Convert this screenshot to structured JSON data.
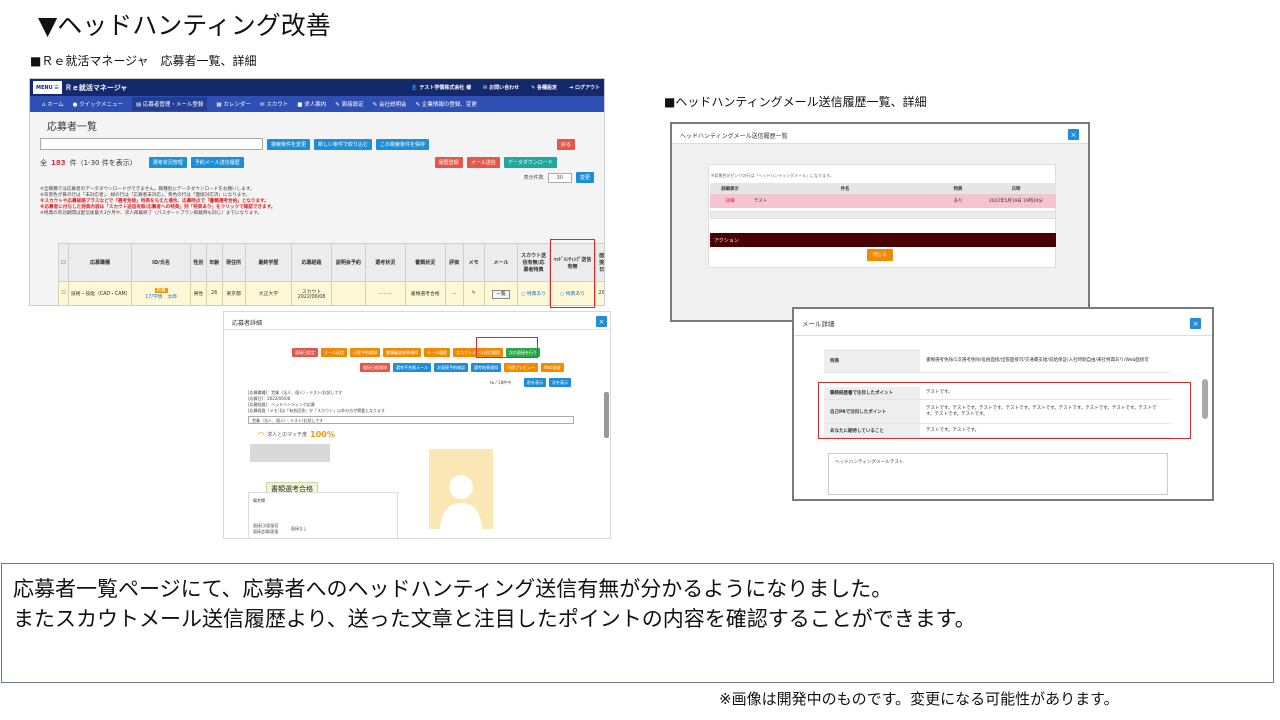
{
  "slide": {
    "title": "▼ヘッドハンティング改善",
    "left_label": "■Ｒｅ就活マネージャ　応募者一覧、詳細",
    "right_label": "■ヘッドハンティングメール送信履歴一覧、詳細",
    "caption_line1": "応募者一覧ページにて、応募者へのヘッドハンティング送信有無が分かるようになりました。",
    "caption_line2": "またスカウトメール送信履歴より、送った文章と注目したポイントの内容を確認することができます。",
    "footnote": "※画像は開発中のものです。変更になる可能性があります。"
  },
  "list_screen": {
    "menu": "MENU",
    "brand": "Ｒｅ就活マネージャ",
    "user": "テスト学情株式会社 様",
    "contact": "お問い合わせ",
    "manual": "各種設定",
    "logout": "ログアウト",
    "nav": [
      "ホーム",
      "クイックメニュー",
      "応募者管理・メール登録",
      "カレンダー",
      "スカウト",
      "求人案内",
      "面接設定",
      "会社説明会",
      "企業情報の登録、変更"
    ],
    "page_title": "応募者一覧",
    "buttons": {
      "change_search": "検索条件を変更",
      "new_search": "新しい条件で絞り込む",
      "save_search": "この検索条件を保存",
      "back": "戻る",
      "status": "選考状況管理",
      "reserve": "予約メール送信履歴",
      "history": "履歴登録",
      "mail": "メール送信",
      "download": "データダウンロード",
      "apply": "変更"
    },
    "count_prefix": "全",
    "count": "183",
    "count_suffix": "件（1-30 件を表示）",
    "per_page_label": "表示件数",
    "per_page": "30",
    "notes": [
      "※全職種では応募者のデータダウンロードができません。職種別にデータダウンロードをお願いします。",
      "※背景色が黄の行は「未対応者」、緑の行は「応募者未対応」、青色の行は「面接対応済」になります。",
      "※スカウトや応募経路プラスなどで「選考免除」特典を与えた場合、応募時点で「書類選考合格」となります。",
      "※応募者に付与した特典内容は「スカウト送信有無/応募者への特典」列「特典あり」をクリックで確認できます。",
      "※特典の有効期間は配信後最大3か月や、求人掲載終了（パスポートプラン掲載時も同じ）までになります。"
    ],
    "table_headers": [
      "応募職種",
      "ID/氏名",
      "性別",
      "年齢",
      "現住所",
      "最終学歴",
      "応募経路",
      "説明会予約",
      "選考状況",
      "書類状況",
      "評価",
      "メモ",
      "メール",
      "スカウト送信有無/応募者特典",
      "ﾍｯﾄﾞﾊﾝﾃｨﾝｸﾞ送信有無",
      "面接日"
    ],
    "row": {
      "job": "技術・技能（CAD・CAM）",
      "tag": "新着",
      "id": "17/学情　太郎",
      "gender": "男性",
      "age": "26",
      "address": "東京都",
      "school": "大正大学",
      "route": "スカウト 2022/06/08",
      "seminar": "",
      "selection": "－－－",
      "doc_status": "書類選考合格",
      "rating": "－",
      "memo": "✎",
      "mail": "一覧",
      "scout": "○ 特典あり",
      "headhunt": "○ 特典あり",
      "date": "20"
    }
  },
  "detail_screen": {
    "title": "応募者詳細",
    "buttons_row1": [
      "面接日設定",
      "メール送信",
      "日程予約通知",
      "書類審査結果通知",
      "メール履歴",
      "スカウトメール送信履歴",
      "次の面接を行う"
    ],
    "buttons_row2": [
      "面接日程通知",
      "選考不合格メール",
      "次面接予約確認",
      "選考結果通知",
      "日程プレビュー",
      "Web面接"
    ],
    "buttons_row3": [
      "前を表示",
      "次を表示"
    ],
    "pager": "№ / 18件中",
    "memo_lines": [
      "[応募職種]：営業（法人、個人）・テスト/お試しです",
      "[応募日]：2022/06/08",
      "[応募経路]：ヘッドハンティング応募",
      "[応募経路（メモ）]は「有効回答」か「スカウト」以外の方が掲載となります"
    ],
    "select_value": "営業（法人、個人）・テスト/お試しです",
    "match_label": "求人とのマッチ度",
    "match_value": "100%",
    "status_chip": "書類選考合格",
    "form_labels": [
      "備考欄",
      "面接日/面接官",
      "面接会場/面接"
    ],
    "form_value": "面接なし"
  },
  "history_screen": {
    "title": "ヘッドハンティングメール送信履歴一覧",
    "note": "※背景色がピンクの行は「ヘッドハンティングメール」になります。",
    "headers": [
      "詳細表示",
      "件名",
      "特典",
      "日時"
    ],
    "row": [
      "詳細",
      "テスト",
      "あり",
      "2022年5月19日 19時24分"
    ],
    "action": "アクション",
    "close": "閉じる"
  },
  "mail_screen": {
    "title": "メール詳細",
    "benefit_label": "特典",
    "benefit_value": "書類選考免除/1次選考免除/役員面接/出張面接可/交通費支給/前給保証/入社時期自由/来社特典あり/Web面接可",
    "point_label": "職務経歴書で注目したポイント",
    "point_value": "テストです。",
    "pr_label": "自己PRで注目したポイント",
    "pr_value": "テストです。テストです。テストです。テストです。テストです。テストです。テストです。テストです。テストです。テストです。テストです。",
    "expect_label": "あなたに期待していること",
    "expect_value": "テストです。テストです。",
    "textarea": "ヘッドハンティングメールテスト"
  }
}
